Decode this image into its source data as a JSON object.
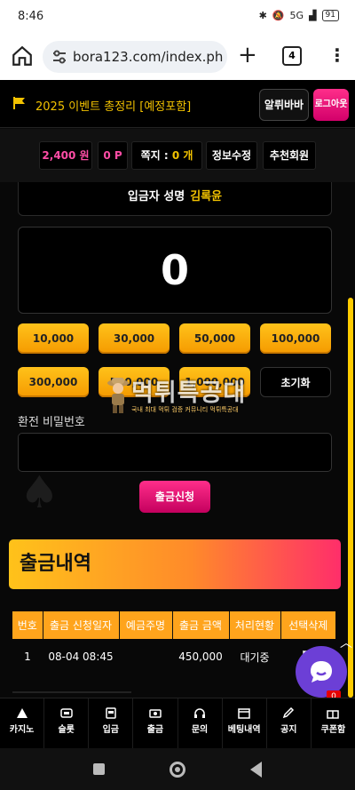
{
  "status": {
    "time": "8:46",
    "network": "5G",
    "battery": "91"
  },
  "browser": {
    "url": "bora123.com/index.php?",
    "tab_count": "4"
  },
  "header": {
    "notice": "2025 이벤트 총정리 [예정포함]",
    "alri_button": "알뤼바바",
    "logout_button": "로그아웃"
  },
  "userbar": {
    "balance": "2,400 원",
    "points": "0 P",
    "message_label": "쪽지 : ",
    "message_count": "0 개",
    "edit_info": "정보수정",
    "referral": "추천회원"
  },
  "withdraw": {
    "depositor_label": "입금자 성명",
    "depositor_name": "김록윤",
    "amount": "0",
    "amount_buttons": [
      "10,000",
      "30,000",
      "50,000",
      "100,000",
      "300,000",
      "500,000",
      "1,000,000"
    ],
    "reset_button": "초기화",
    "password_label": "환전 비밀번호",
    "password_value": "",
    "submit_button": "출금신청"
  },
  "watermark": {
    "main": "먹튀특공대",
    "sub": "국내 최대 먹튀 검증 커뮤니티 먹튀특공대"
  },
  "history": {
    "title": "출금내역",
    "columns": [
      "번호",
      "출금 신청일자",
      "예금주명",
      "출금 금액",
      "처리현황",
      "선택삭제"
    ],
    "rows": [
      {
        "no": "1",
        "date": "08-04 08:45",
        "holder": "",
        "amount": "450,000",
        "status": "대기중"
      }
    ]
  },
  "bottom_nav": [
    "카지노",
    "슬롯",
    "입금",
    "출금",
    "문의",
    "베팅내역",
    "공지",
    "쿠폰함"
  ],
  "coupon_badge": "0",
  "colors": {
    "gold": "#f2c200",
    "pink": "#ff2e8a",
    "orange": "#ffa41c",
    "chat": "#6c3fd6"
  }
}
